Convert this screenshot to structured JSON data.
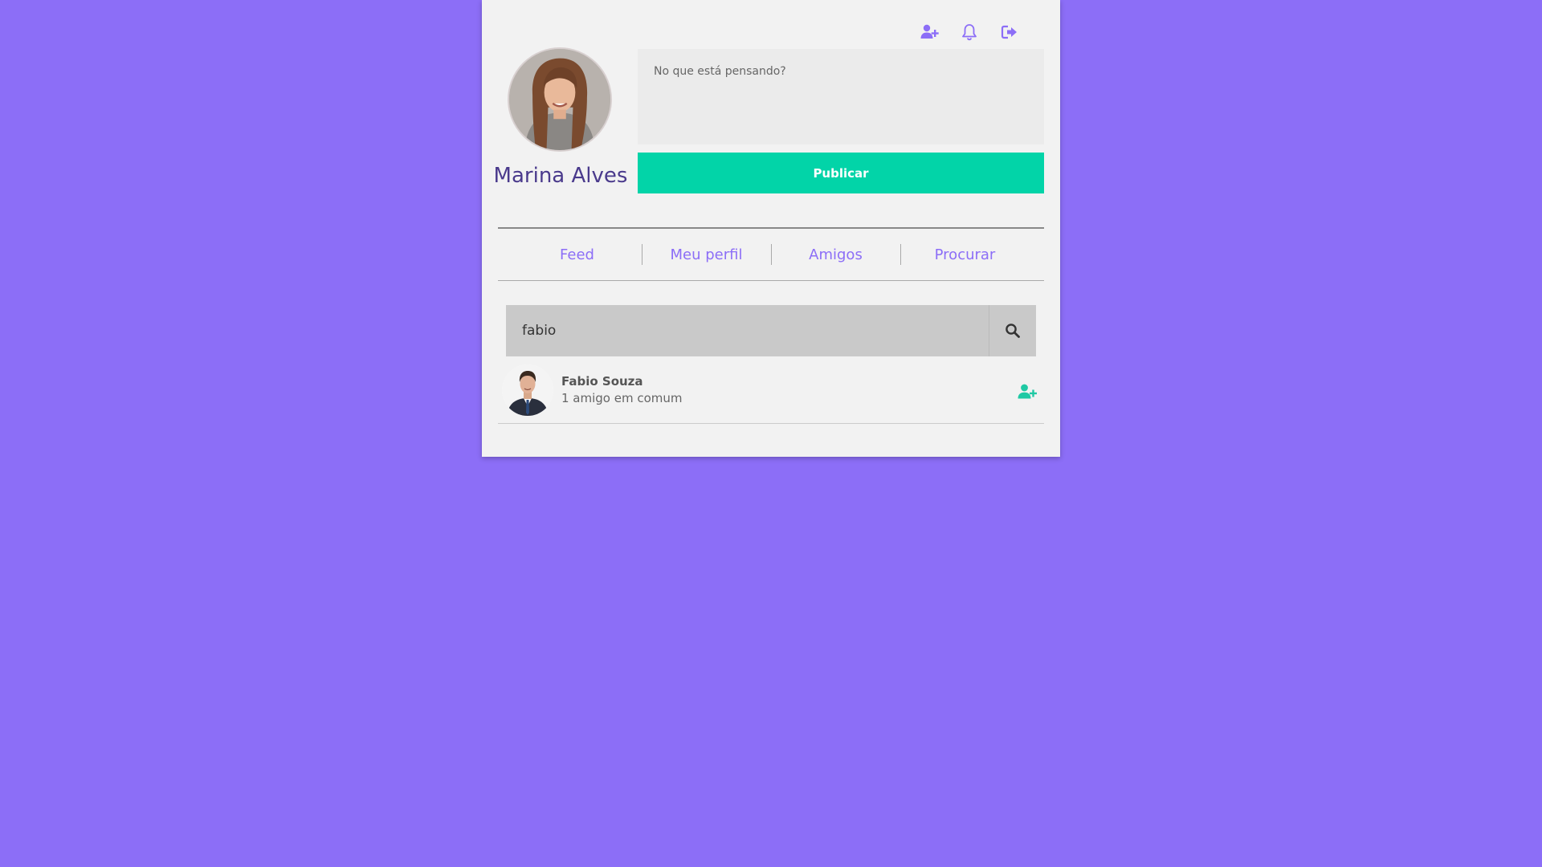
{
  "header": {
    "icons": [
      "add-user-icon",
      "bell-icon",
      "sign-out-icon"
    ]
  },
  "profile": {
    "name": "Marina Alves"
  },
  "post": {
    "placeholder": "No que está pensando?",
    "publish_label": "Publicar"
  },
  "nav": {
    "items": [
      {
        "label": "Feed"
      },
      {
        "label": "Meu perfil"
      },
      {
        "label": "Amigos"
      },
      {
        "label": "Procurar"
      }
    ]
  },
  "search": {
    "value": "fabio",
    "button_icon": "search-icon"
  },
  "results": [
    {
      "name": "Fabio Souza",
      "mutual": "1 amigo em comum",
      "action_icon": "add-user-icon"
    }
  ],
  "colors": {
    "background": "#8c6ef7",
    "accent": "#8c6ef7",
    "publish": "#02d4a8",
    "add_friend": "#1fc9a4",
    "name_text": "#4a3a8c"
  }
}
